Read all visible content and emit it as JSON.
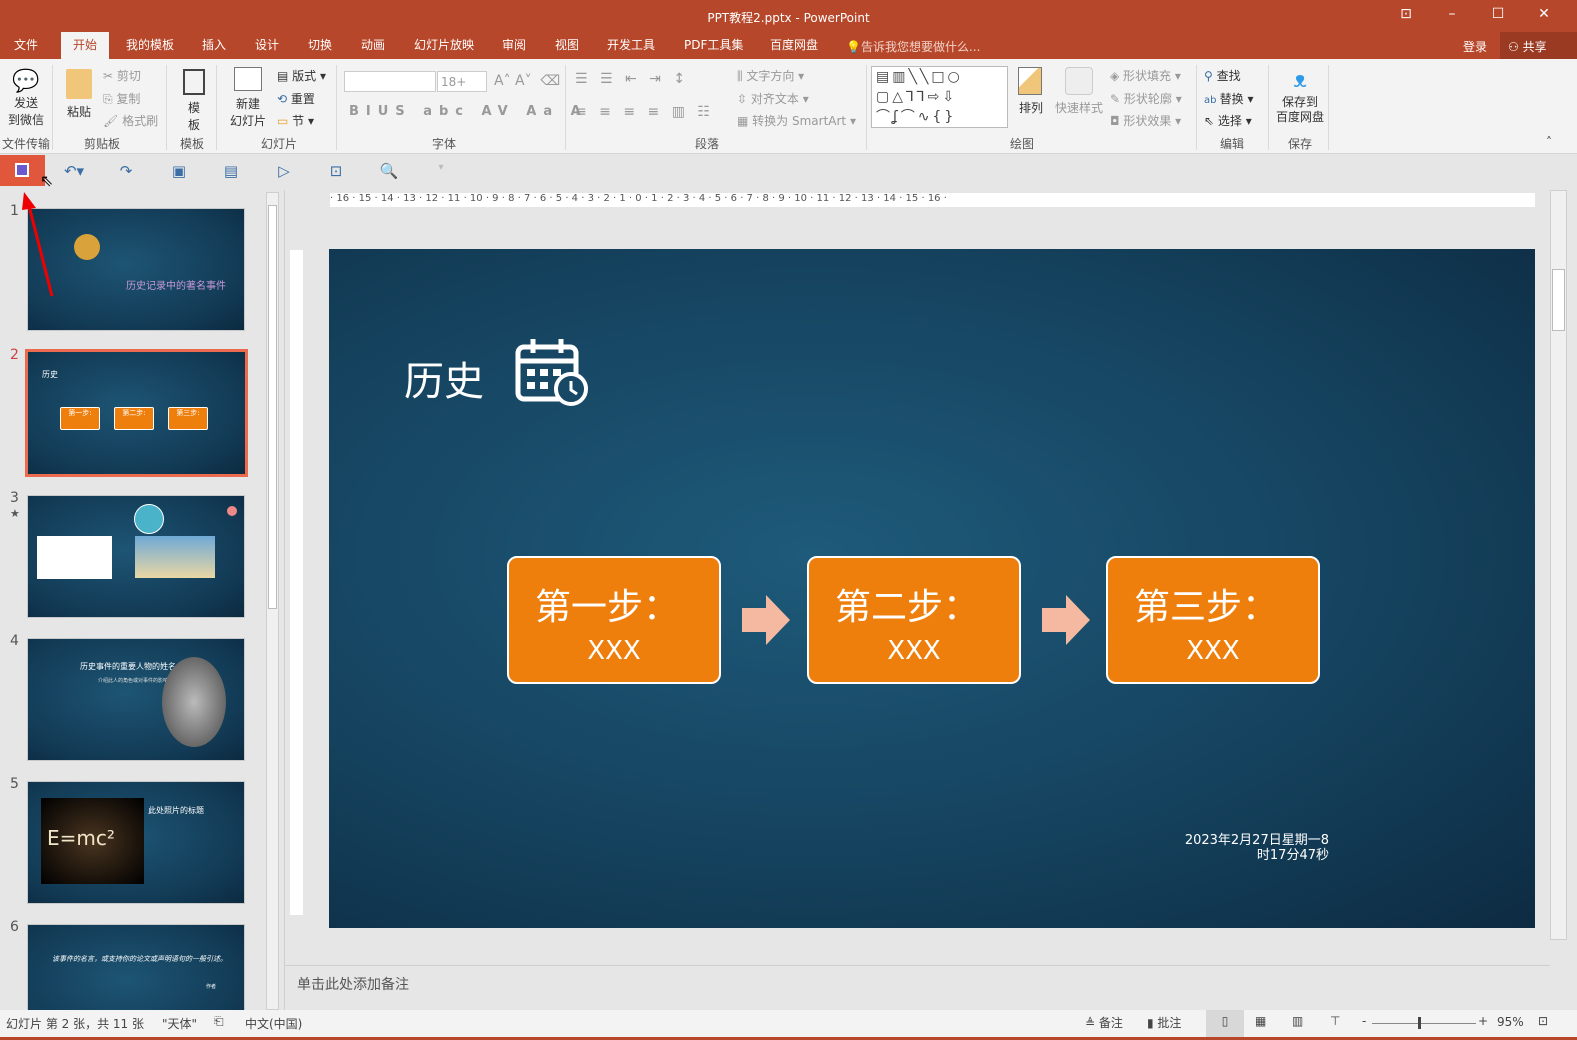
{
  "window": {
    "title": "PPT教程2.pptx - PowerPoint",
    "restore_icon": "ribbon-display-icon",
    "minimize": "–",
    "maximize": "☐",
    "close": "✕"
  },
  "tabs": [
    "文件",
    "开始",
    "我的模板",
    "插入",
    "设计",
    "切换",
    "动画",
    "幻灯片放映",
    "审阅",
    "视图",
    "开发工具",
    "PDF工具集",
    "百度网盘"
  ],
  "tell_me": "告诉我您想要做什么...",
  "login": "登录",
  "share": "共享",
  "ribbon": {
    "file_transfer": {
      "btn": "发送\n到微信",
      "label": "文件传输"
    },
    "clipboard": {
      "paste": "粘贴",
      "cut": "剪切",
      "copy": "复制",
      "format_painter": "格式刷",
      "label": "剪贴板"
    },
    "template": {
      "btn": "模\n板",
      "label": "模板"
    },
    "slides": {
      "new": "新建\n幻灯片",
      "layout": "版式",
      "reset": "重置",
      "section": "节",
      "label": "幻灯片"
    },
    "font": {
      "name": "",
      "size": "18+",
      "label": "字体"
    },
    "paragraph": {
      "text_direction": "文字方向",
      "align_text": "对齐文本",
      "smartart": "转换为 SmartArt",
      "label": "段落"
    },
    "drawing": {
      "arrange": "排列",
      "quick_styles": "快速样式",
      "fill": "形状填充",
      "outline": "形状轮廓",
      "effects": "形状效果",
      "label": "绘图"
    },
    "editing": {
      "find": "查找",
      "replace": "替换",
      "select": "选择",
      "label": "编辑"
    },
    "save": {
      "btn": "保存到\n百度网盘",
      "label": "保存"
    }
  },
  "ruler_h": "· 16 · 15 · 14 · 13 · 12 · 11 · 10 · 9 · 8 · 7 · 6 · 5 · 4 · 3 · 2 · 1 · 0 · 1 · 2 · 3 · 4 · 5 · 6 · 7 · 8 · 9 · 10 · 11 · 12 · 13 · 14 · 15 · 16 ·",
  "thumbnails": [
    {
      "num": "1",
      "title": "历史记录中的著名事件"
    },
    {
      "num": "2",
      "title": "历史",
      "steps": [
        "第一步:",
        "第二步:",
        "第三步:"
      ]
    },
    {
      "num": "3",
      "mark": "★"
    },
    {
      "num": "4",
      "title": "历史事件的重要人物的姓名",
      "sub": "介绍此人的角色或对事件的影响。"
    },
    {
      "num": "5",
      "title": "此处照片的标题",
      "formula": "E=mc²"
    },
    {
      "num": "6",
      "quote": "该事件的名言，或支持你的论文或声明语句的一般引述。",
      "author": "作者"
    }
  ],
  "slide": {
    "title": "历史",
    "steps": [
      {
        "label": "第一步：",
        "value": "XXX"
      },
      {
        "label": "第二步：",
        "value": "XXX"
      },
      {
        "label": "第三步：",
        "value": "XXX"
      }
    ],
    "date_line1": "2023年2月27日星期一8",
    "date_line2": "时17分47秒",
    "colors": {
      "box": "#ef7f0d",
      "arrow": "#f4b9a0",
      "bg": "#15435f"
    }
  },
  "notes_placeholder": "单击此处添加备注",
  "status": {
    "slide_info": "幻灯片 第 2 张，共 11 张",
    "theme": "\"天体\"",
    "language": "中文(中国)",
    "notes": "备注",
    "comments": "批注",
    "zoom": "95%"
  }
}
